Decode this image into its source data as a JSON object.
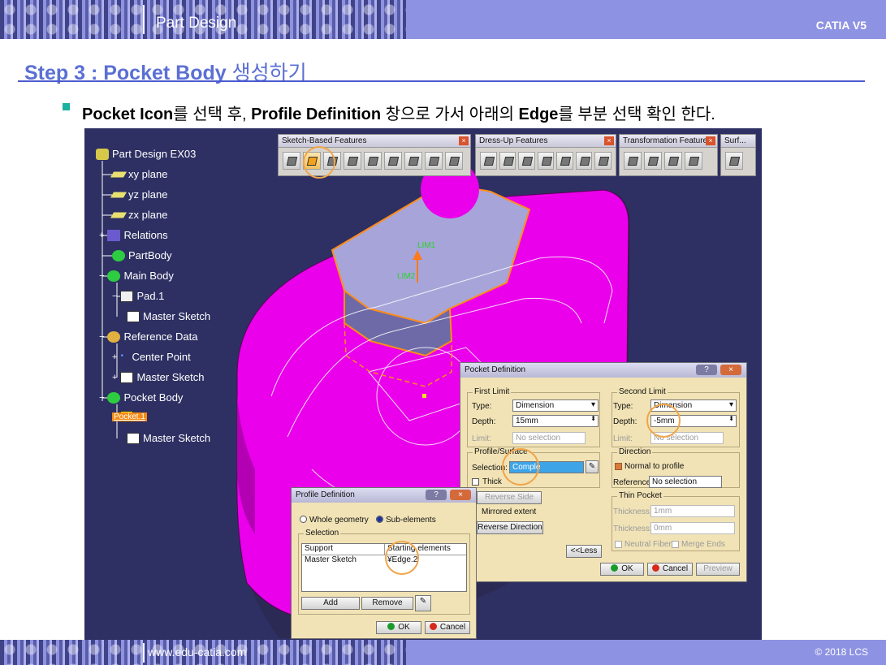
{
  "header": {
    "title": "Part Design",
    "brand": "CATIA V5"
  },
  "footer": {
    "website": "www.edu-catia.com",
    "copyright": "© 2018 LCS"
  },
  "step": {
    "title_en": "Step 3 : Pocket Body",
    "title_kr": "생성하기"
  },
  "instruction": {
    "p1": "Pocket Icon",
    "p2": "를 선택 후, ",
    "p3": "Profile Definition",
    "p4": " 창으로 가서 아래의 ",
    "p5": "Edge",
    "p6": "를 부분 선택 확인 한다."
  },
  "tree": {
    "root": "Part Design EX03",
    "xy": "xy plane",
    "yz": "yz plane",
    "zx": "zx plane",
    "relations": "Relations",
    "partbody": "PartBody",
    "mainbody": "Main Body",
    "pad": "Pad.1",
    "sketch1": "Master Sketch",
    "refdata": "Reference Data",
    "center": "Center Point",
    "sketch2": "Master Sketch",
    "pocketbody": "Pocket Body",
    "pocket": "Pocket.1",
    "sketch3": "Master Sketch"
  },
  "toolbars": {
    "sketch_based": "Sketch-Based Features",
    "dress_up": "Dress-Up Features",
    "transformation": "Transformation Features",
    "surf": "Surf..."
  },
  "model": {
    "dim1": "LIM1",
    "dim2": "LIM2"
  },
  "pocket_dialog": {
    "title": "Pocket Definition",
    "first_limit": "First Limit",
    "type_label": "Type:",
    "type_value": "Dimension",
    "depth_label": "Depth:",
    "depth_value": "15mm",
    "limit_label": "Limit:",
    "limit_value": "No selection",
    "profile_surface": "Profile/Surface",
    "selection_label": "Selection:",
    "selection_value": "Comple",
    "thick": "Thick",
    "reverse_side": "Reverse Side",
    "mirrored_extent": "Mirrored extent",
    "reverse_direction": "Reverse Direction",
    "second_limit": "Second Limit",
    "type2_value": "Dimension",
    "depth2_value": "-5mm",
    "limit2_value": "No selection",
    "direction": "Direction",
    "normal_to_profile": "Normal to profile",
    "reference_label": "Reference:",
    "reference_value": "No selection",
    "thin_pocket": "Thin Pocket",
    "thickness1_label": "Thickness1:",
    "thickness1_value": "1mm",
    "thickness2_label": "Thickness2:",
    "thickness2_value": "0mm",
    "neutral_fiber": "Neutral Fiber",
    "merge_ends": "Merge Ends",
    "less": "<<Less",
    "ok": "OK",
    "cancel": "Cancel",
    "preview": "Preview",
    "help": "?",
    "close": "×"
  },
  "profile_dialog": {
    "title": "Profile Definition",
    "whole_geometry": "Whole geometry",
    "sub_elements": "Sub-elements",
    "selection": "Selection",
    "col_support": "Support",
    "col_starting": "Starting elements",
    "row_support": "Master Sketch",
    "row_starting": "¥Edge.2",
    "add": "Add",
    "remove": "Remove",
    "ok": "OK",
    "cancel": "Cancel",
    "help": "?",
    "close": "×"
  }
}
